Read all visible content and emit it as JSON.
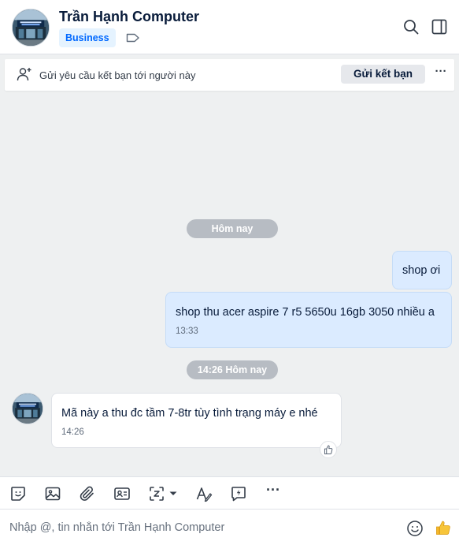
{
  "header": {
    "title": "Trần Hạnh Computer",
    "badge": "Business",
    "icons": [
      "label-tag-icon",
      "search-icon",
      "sidebar-toggle-icon"
    ]
  },
  "friend_bar": {
    "text": "Gửi yêu cầu kết bạn tới người này",
    "button": "Gửi kết bạn",
    "more": "···"
  },
  "messages": {
    "divider_1": "Hôm nay",
    "out_1_text": "shop ơi",
    "out_2_text": "shop thu acer aspire 7 r5 5650u 16gb 3050 nhiều a",
    "out_2_time": "13:33",
    "divider_2": "14:26 Hôm nay",
    "in_1_text": "Mã này a thu đc tầm 7-8tr tùy tình trạng máy e nhé",
    "in_1_time": "14:26"
  },
  "toolbar": {
    "icons": [
      "sticker-icon",
      "image-icon",
      "attachment-icon",
      "contact-card-icon",
      "screenshot-icon",
      "text-format-icon",
      "quick-message-icon"
    ],
    "more": "···"
  },
  "composer": {
    "placeholder": "Nhập @, tin nhắn tới Trần Hạnh Computer"
  },
  "colors": {
    "accent": "#0068ff",
    "outgoing_bubble": "#dbebff",
    "chat_background": "#eef0f1"
  }
}
